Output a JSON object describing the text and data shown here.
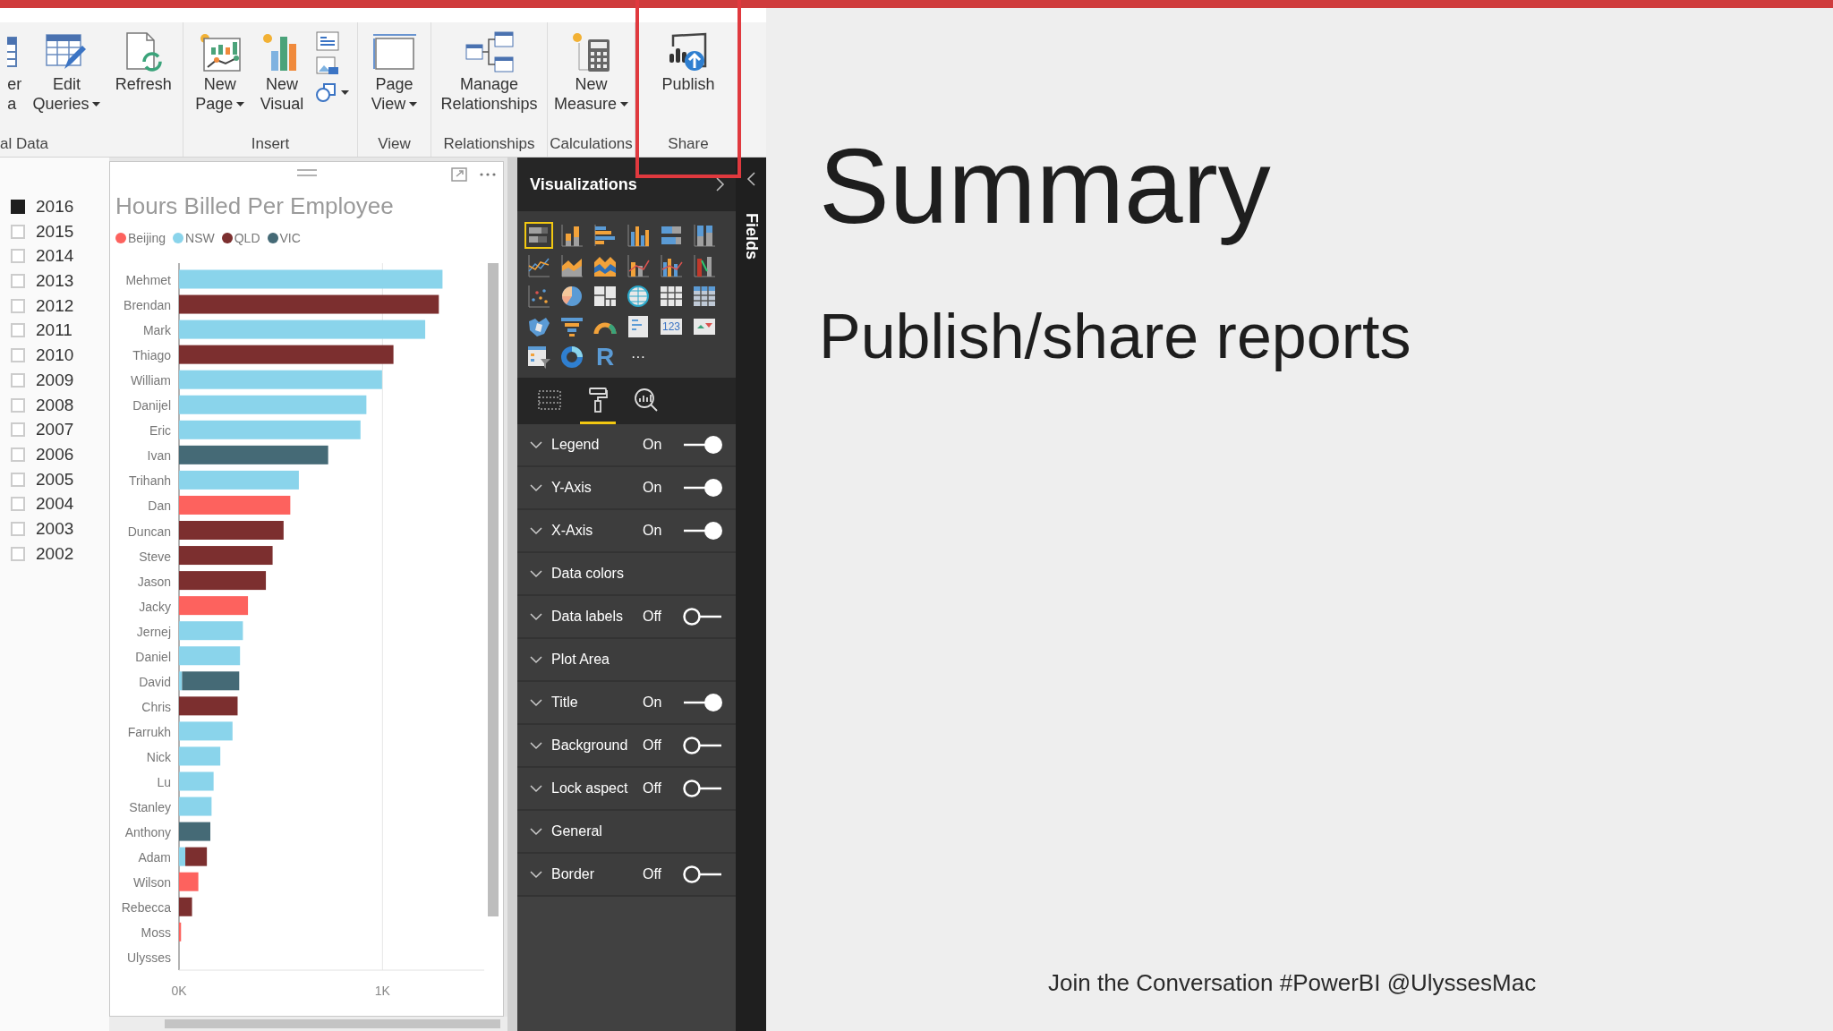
{
  "ribbon": {
    "groups": [
      {
        "label": "al Data",
        "buttons": [
          {
            "kind": "table",
            "lines": [
              "er",
              "a"
            ]
          },
          {
            "kind": "edit-table",
            "lines": [
              "Edit",
              "Queries"
            ],
            "dropdown": true
          },
          {
            "kind": "refresh",
            "lines": [
              "Refresh"
            ]
          }
        ]
      },
      {
        "label": "Insert",
        "buttons": [
          {
            "kind": "new-page",
            "lines": [
              "New",
              "Page"
            ],
            "dropdown": true
          },
          {
            "kind": "new-visual",
            "lines": [
              "New",
              "Visual"
            ]
          }
        ],
        "small_buttons": [
          {
            "kind": "textbox"
          },
          {
            "kind": "image"
          },
          {
            "kind": "shapes",
            "dropdown": true
          }
        ]
      },
      {
        "label": "View",
        "buttons": [
          {
            "kind": "page-view",
            "lines": [
              "Page",
              "View"
            ],
            "dropdown": true
          }
        ]
      },
      {
        "label": "Relationships",
        "buttons": [
          {
            "kind": "relationships",
            "lines": [
              "Manage",
              "Relationships"
            ]
          }
        ]
      },
      {
        "label": "Calculations",
        "buttons": [
          {
            "kind": "calculator",
            "lines": [
              "New",
              "Measure"
            ],
            "dropdown": true
          }
        ]
      },
      {
        "label": "Share",
        "buttons": [
          {
            "kind": "publish",
            "lines": [
              "Publish"
            ]
          }
        ]
      }
    ]
  },
  "slicer": [
    {
      "label": "2016",
      "checked": true
    },
    {
      "label": "2015",
      "checked": false
    },
    {
      "label": "2014",
      "checked": false
    },
    {
      "label": "2013",
      "checked": false
    },
    {
      "label": "2012",
      "checked": false
    },
    {
      "label": "2011",
      "checked": false
    },
    {
      "label": "2010",
      "checked": false
    },
    {
      "label": "2009",
      "checked": false
    },
    {
      "label": "2008",
      "checked": false
    },
    {
      "label": "2007",
      "checked": false
    },
    {
      "label": "2006",
      "checked": false
    },
    {
      "label": "2005",
      "checked": false
    },
    {
      "label": "2004",
      "checked": false
    },
    {
      "label": "2003",
      "checked": false
    },
    {
      "label": "2002",
      "checked": false
    }
  ],
  "visual": {
    "title": "Hours Billed Per Employee",
    "chart_data": {
      "type": "bar",
      "orientation": "horizontal",
      "stacked": true,
      "categories": [
        "Mehmet",
        "Brendan",
        "Mark",
        "Thiago",
        "William",
        "Danijel",
        "Eric",
        "Ivan",
        "Trihanh",
        "Dan",
        "Duncan",
        "Steve",
        "Jason",
        "Jacky",
        "Jernej",
        "Daniel",
        "David",
        "Chris",
        "Farrukh",
        "Nick",
        "Lu",
        "Stanley",
        "Anthony",
        "Adam",
        "Wilson",
        "Rebecca",
        "Moss",
        "Ulysses"
      ],
      "series": [
        {
          "name": "Beijing",
          "color": "#fd625e",
          "values": [
            null,
            null,
            null,
            null,
            null,
            null,
            null,
            null,
            null,
            547,
            null,
            null,
            null,
            339,
            null,
            null,
            null,
            null,
            null,
            null,
            null,
            null,
            null,
            null,
            95,
            null,
            10,
            null
          ]
        },
        {
          "name": "NSW",
          "color": "#8ad4eb",
          "values": [
            1295,
            null,
            1210,
            null,
            998,
            921,
            892,
            null,
            589,
            null,
            null,
            null,
            null,
            null,
            314,
            300,
            15,
            null,
            263,
            203,
            170,
            160,
            null,
            31,
            null,
            null,
            null,
            null
          ]
        },
        {
          "name": "QLD",
          "color": "#7c2f2f",
          "values": [
            null,
            1277,
            null,
            1054,
            null,
            null,
            null,
            null,
            null,
            null,
            514,
            460,
            427,
            null,
            null,
            null,
            null,
            288,
            null,
            null,
            null,
            null,
            null,
            106,
            null,
            64,
            null,
            null
          ]
        },
        {
          "name": "VIC",
          "color": "#456a76",
          "values": [
            null,
            null,
            null,
            null,
            null,
            null,
            null,
            733,
            null,
            null,
            null,
            null,
            null,
            null,
            null,
            null,
            281,
            null,
            null,
            null,
            null,
            null,
            154,
            null,
            null,
            null,
            null,
            null
          ]
        }
      ],
      "xlim": [
        0,
        1500
      ],
      "xticks": [
        {
          "value": 0,
          "label": "0K"
        },
        {
          "value": 1000,
          "label": "1K"
        }
      ]
    }
  },
  "visualizations": {
    "title": "Visualizations",
    "types": [
      {
        "kind": "stacked-bar",
        "selected": true
      },
      {
        "kind": "stacked-column",
        "selected": false
      },
      {
        "kind": "clustered-bar",
        "selected": false
      },
      {
        "kind": "clustered-column",
        "selected": false
      },
      {
        "kind": "percent-bar",
        "selected": false
      },
      {
        "kind": "percent-column",
        "selected": false
      },
      {
        "kind": "line",
        "selected": false
      },
      {
        "kind": "area",
        "selected": false
      },
      {
        "kind": "stacked-area",
        "selected": false
      },
      {
        "kind": "line-column",
        "selected": false
      },
      {
        "kind": "line-clustered-column",
        "selected": false
      },
      {
        "kind": "ribbon",
        "selected": false
      },
      {
        "kind": "scatter",
        "selected": false
      },
      {
        "kind": "pie",
        "selected": false
      },
      {
        "kind": "treemap",
        "selected": false
      },
      {
        "kind": "globe",
        "selected": false
      },
      {
        "kind": "table",
        "selected": false
      },
      {
        "kind": "matrix",
        "selected": false
      },
      {
        "kind": "filled-map",
        "selected": false
      },
      {
        "kind": "funnel",
        "selected": false
      },
      {
        "kind": "gauge",
        "selected": false
      },
      {
        "kind": "multi-card",
        "selected": false
      },
      {
        "kind": "card",
        "label": "123",
        "selected": false
      },
      {
        "kind": "kpi",
        "selected": false
      },
      {
        "kind": "slicer",
        "selected": false
      },
      {
        "kind": "donut",
        "selected": false
      },
      {
        "kind": "r-script",
        "label": "R",
        "selected": false
      },
      {
        "kind": "more",
        "label": "···",
        "selected": false
      }
    ],
    "tabs": [
      {
        "kind": "fields",
        "selected": false
      },
      {
        "kind": "format",
        "selected": true
      },
      {
        "kind": "analytics",
        "selected": false
      }
    ],
    "format_rows": [
      {
        "kind": "toggle",
        "label": "Legend",
        "state": "On",
        "on": true
      },
      {
        "kind": "toggle",
        "label": "Y-Axis",
        "state": "On",
        "on": true
      },
      {
        "kind": "toggle",
        "label": "X-Axis",
        "state": "On",
        "on": true
      },
      {
        "kind": "section",
        "label": "Data colors"
      },
      {
        "kind": "toggle",
        "label": "Data labels",
        "state": "Off",
        "on": false
      },
      {
        "kind": "section",
        "label": "Plot Area"
      },
      {
        "kind": "toggle",
        "label": "Title",
        "state": "On",
        "on": true
      },
      {
        "kind": "toggle",
        "label": "Background",
        "state": "Off",
        "on": false
      },
      {
        "kind": "toggle",
        "label": "Lock aspect",
        "state": "Off",
        "on": false
      },
      {
        "kind": "section",
        "label": "General"
      },
      {
        "kind": "toggle",
        "label": "Border",
        "state": "Off",
        "on": false
      }
    ]
  },
  "fields_pane": {
    "label": "Fields"
  },
  "slide": {
    "title": "Summary",
    "subtitle": "Publish/share reports",
    "footer": "Join the Conversation #PowerBI @UlyssesMac"
  }
}
